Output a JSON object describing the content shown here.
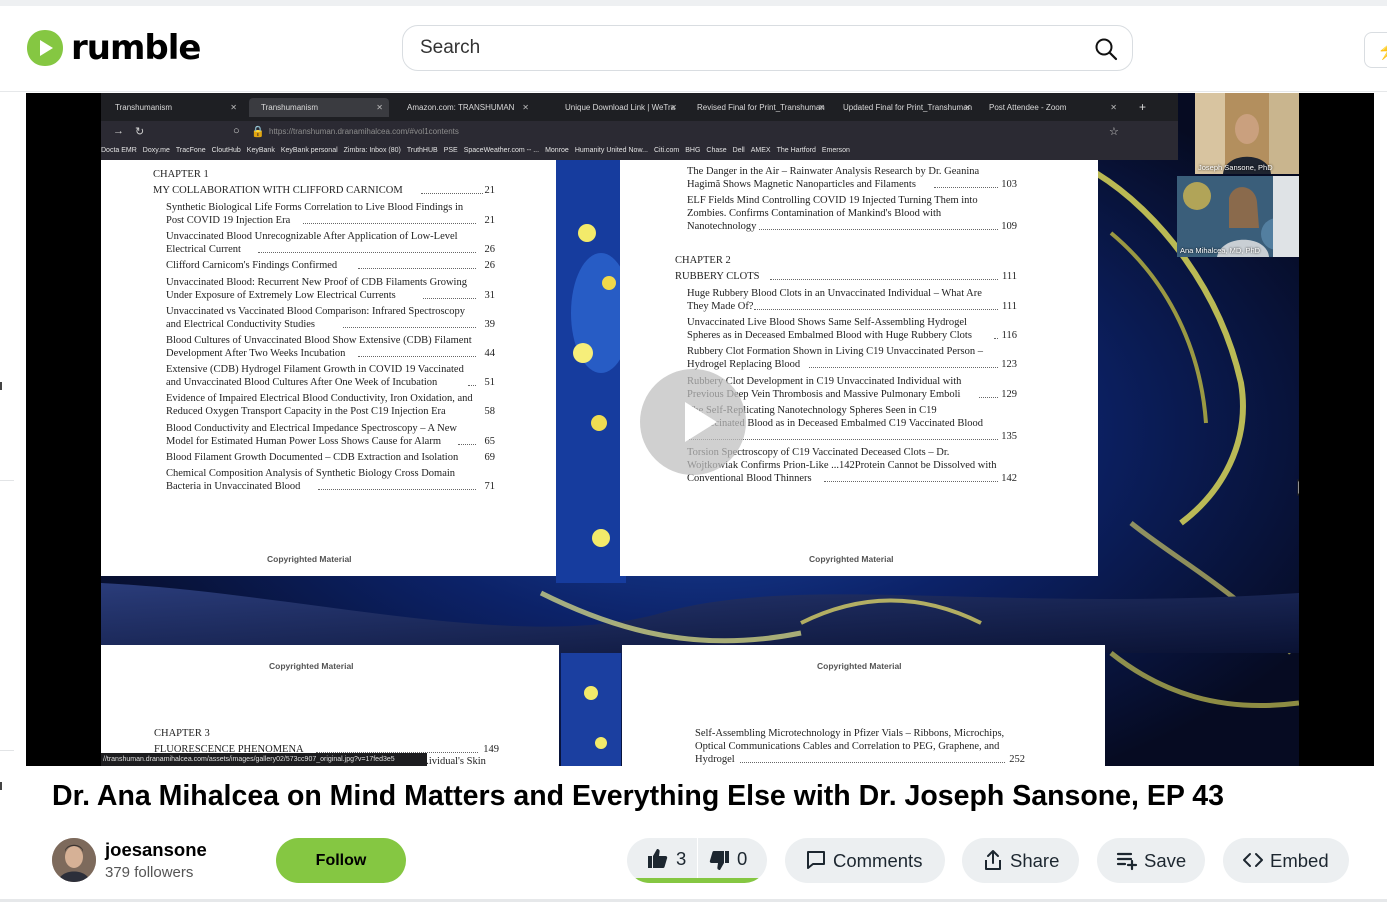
{
  "site": {
    "logo_text": "rumble",
    "brand_color": "#85c742"
  },
  "search": {
    "placeholder": "Search",
    "icon": "search-icon"
  },
  "video": {
    "browser_tabs": [
      "Transhumanism",
      "Transhumanism",
      "Amazon.com: TRANSHUMAN",
      "Unique Download Link | WeTra",
      "Revised Final for Print_Transhuman",
      "Updated Final for Print_Transhuman",
      "Post Attendee - Zoom"
    ],
    "url": "https://transhuman.dranamihalcea.com/#vol1contents",
    "bookmarks": [
      "Docta EMR",
      "Doxy.me",
      "TracFone",
      "CloutHub",
      "KeyBank",
      "KeyBank personal",
      "Zimbra: Inbox (80)",
      "TruthHUB",
      "PSE",
      "SpaceWeather.com -- ...",
      "Monroe",
      "Humanity United Now...",
      "Citi.com",
      "BHG",
      "Chase",
      "Dell",
      "AMEX",
      "The Hartford",
      "Emerson"
    ],
    "left_page": {
      "chapter": "CHAPTER 1",
      "chapter_title": "MY COLLABORATION WITH CLIFFORD CARNICOM",
      "chapter_page": "21",
      "entries": [
        {
          "lines": [
            "Synthetic Biological Life Forms Correlation to Live Blood Findings in",
            "Post COVID 19 Injection Era"
          ],
          "page": "21"
        },
        {
          "lines": [
            "Unvaccinated Blood Unrecognizable After Application of Low-Level",
            "Electrical Current"
          ],
          "page": "26"
        },
        {
          "lines": [
            "Clifford Carnicom's Findings Confirmed"
          ],
          "page": "26"
        },
        {
          "lines": [
            "Unvaccinated Blood: Recurrent New Proof of CDB Filaments Growing",
            "Under Exposure of Extremely Low Electrical Currents"
          ],
          "page": "31"
        },
        {
          "lines": [
            "Unvaccinated vs Vaccinated Blood Comparison: Infrared Spectroscopy",
            "and Electrical Conductivity Studies"
          ],
          "page": "39"
        },
        {
          "lines": [
            "Blood Cultures of Unvaccinated Blood Show Extensive (CDB) Filament",
            "Development After Two Weeks Incubation"
          ],
          "page": "44"
        },
        {
          "lines": [
            "Extensive (CDB) Hydrogel Filament Growth in COVID 19 Vaccinated",
            "and Unvaccinated Blood Cultures After One Week of Incubation"
          ],
          "page": "51"
        },
        {
          "lines": [
            "Evidence of Impaired Electrical Blood Conductivity, Iron Oxidation, and",
            "Reduced Oxygen Transport Capacity in the Post C19 Injection Era"
          ],
          "page": "58"
        },
        {
          "lines": [
            "Blood Conductivity and Electrical Impedance Spectroscopy – A New",
            "Model for Estimated Human Power Loss Shows Cause for Alarm"
          ],
          "page": "65"
        },
        {
          "lines": [
            "Blood Filament Growth Documented – CDB Extraction and Isolation"
          ],
          "page": "69"
        },
        {
          "lines": [
            "Chemical Composition Analysis of Synthetic Biology Cross Domain",
            "Bacteria in Unvaccinated Blood"
          ],
          "page": "71"
        }
      ],
      "footer": "Copyrighted Material"
    },
    "right_page": {
      "entries_top": [
        {
          "lines": [
            "The Danger in the Air – Rainwater Analysis Research by Dr. Geanina",
            "Hagimă Shows Magnetic Nanoparticles and Filaments"
          ],
          "page": "103"
        },
        {
          "lines": [
            "ELF Fields Mind Controlling COVID 19 Injected Turning Them into",
            "Zombies. Confirms Contamination of Mankind's Blood with",
            "Nanotechnology"
          ],
          "page": "109"
        }
      ],
      "chapter": "CHAPTER 2",
      "chapter_title": "RUBBERY CLOTS",
      "chapter_page": "111",
      "entries": [
        {
          "lines": [
            "Huge Rubbery Blood Clots in an Unvaccinated Individual – What Are",
            "They Made Of?"
          ],
          "page": "111"
        },
        {
          "lines": [
            "Unvaccinated Live Blood Shows Same Self-Assembling Hydrogel",
            "Spheres as in Deceased Embalmed Blood with Huge Rubbery Clots"
          ],
          "page": "116"
        },
        {
          "lines": [
            "Rubbery Clot Formation Shown in Living C19 Unvaccinated Person –",
            "Hydrogel Replacing Blood"
          ],
          "page": "123"
        },
        {
          "lines": [
            "Rubbery Clot Development in C19 Unvaccinated Individual with",
            "Previous Deep Vein Thrombosis and Massive Pulmonary Emboli"
          ],
          "page": "129"
        },
        {
          "lines": [
            "The Self-Replicating Nanotechnology Spheres Seen in C19",
            "Unvaccinated Blood as in Deceased Embalmed C19 Vaccinated Blood",
            ""
          ],
          "page": "135"
        },
        {
          "lines": [
            "Torsion Spectroscopy of C19 Vaccinated Deceased Clots – Dr.",
            "Wojtkowiak Confirms Prion-Like ...142Protein Cannot be Dissolved with",
            "Conventional Blood Thinners"
          ],
          "page": "142"
        }
      ],
      "footer": "Copyrighted Material"
    },
    "lower_left_page": {
      "header": "Copyrighted Material",
      "chapter": "CHAPTER 3",
      "chapter_title": "FLUORESCENCE PHENOMENA",
      "chapter_page": "149",
      "partial": "...ividual's Skin"
    },
    "lower_right_page": {
      "header": "Copyrighted Material",
      "lines": [
        "Self-Assembling Microtechnology in Pfizer Vials – Ribbons, Microchips,",
        "Optical Communications Cables and Correlation to PEG, Graphene, and",
        "Hydrogel"
      ],
      "page": "252"
    },
    "webcams": [
      {
        "name": "Joseph Sansone, PhD"
      },
      {
        "name": "Ana Mihalcea, MD, PhD"
      }
    ],
    "status_url": "//transhuman.dranamihalcea.com/assets/images/gallery02/573cc907_original.jpg?v=17fed3e5"
  },
  "title": "Dr. Ana Mihalcea on Mind Matters and Everything Else with Dr. Joseph Sansone, EP 43",
  "channel": {
    "name": "joesansone",
    "followers": "379 followers",
    "follow_label": "Follow"
  },
  "actions": {
    "likes": "3",
    "dislikes": "0",
    "like_fraction": 1.0,
    "comments_label": "Comments",
    "share_label": "Share",
    "save_label": "Save",
    "embed_label": "Embed"
  }
}
